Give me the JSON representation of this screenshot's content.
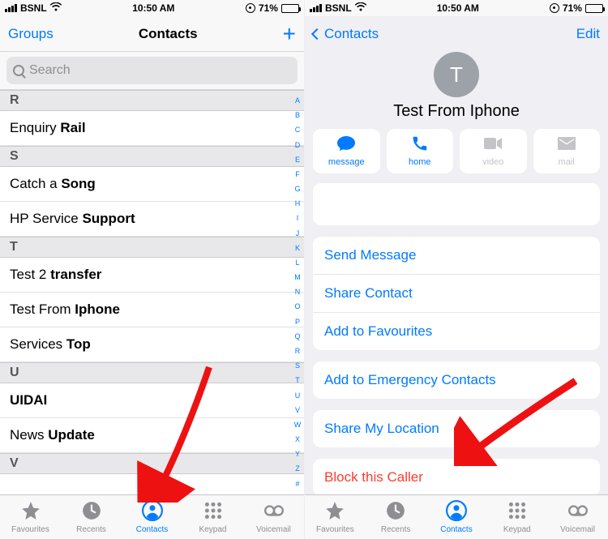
{
  "status_bar": {
    "carrier": "BSNL",
    "time": "10:50 AM",
    "battery_pct": "71%"
  },
  "left": {
    "nav": {
      "left": "Groups",
      "title": "Contacts"
    },
    "search_placeholder": "Search",
    "sections": [
      {
        "letter": "R",
        "rows": [
          {
            "first": "Enquiry ",
            "last": "Rail"
          }
        ]
      },
      {
        "letter": "S",
        "rows": [
          {
            "first": "Catch a ",
            "last": "Song"
          },
          {
            "first": "HP Service ",
            "last": "Support"
          }
        ]
      },
      {
        "letter": "T",
        "rows": [
          {
            "first": "Test 2 ",
            "last": "transfer"
          },
          {
            "first": "Test From ",
            "last": "Iphone"
          },
          {
            "first": "Services ",
            "last": "Top"
          }
        ]
      },
      {
        "letter": "U",
        "rows": [
          {
            "first": "",
            "last": "UIDAI"
          },
          {
            "first": "News ",
            "last": "Update"
          }
        ]
      },
      {
        "letter": "V",
        "rows": []
      }
    ],
    "index_strip": [
      "A",
      "B",
      "C",
      "D",
      "E",
      "F",
      "G",
      "H",
      "I",
      "J",
      "K",
      "L",
      "M",
      "N",
      "O",
      "P",
      "Q",
      "R",
      "S",
      "T",
      "U",
      "V",
      "W",
      "X",
      "Y",
      "Z",
      "#"
    ]
  },
  "right": {
    "nav": {
      "back": "Contacts",
      "edit": "Edit"
    },
    "avatar_initial": "T",
    "contact_name": "Test From Iphone",
    "quick_actions": [
      {
        "key": "message",
        "label": "message",
        "enabled": true
      },
      {
        "key": "home",
        "label": "home",
        "enabled": true
      },
      {
        "key": "video",
        "label": "video",
        "enabled": false
      },
      {
        "key": "mail",
        "label": "mail",
        "enabled": false
      }
    ],
    "action_groups": [
      [
        {
          "label": "Send Message"
        },
        {
          "label": "Share Contact"
        },
        {
          "label": "Add to Favourites"
        }
      ],
      [
        {
          "label": "Add to Emergency Contacts"
        }
      ],
      [
        {
          "label": "Share My Location"
        }
      ],
      [
        {
          "label": "Block this Caller",
          "destructive": true
        }
      ]
    ]
  },
  "tabs": [
    {
      "key": "favourites",
      "label": "Favourites"
    },
    {
      "key": "recents",
      "label": "Recents"
    },
    {
      "key": "contacts",
      "label": "Contacts"
    },
    {
      "key": "keypad",
      "label": "Keypad"
    },
    {
      "key": "voicemail",
      "label": "Voicemail"
    }
  ],
  "active_tab": "contacts"
}
